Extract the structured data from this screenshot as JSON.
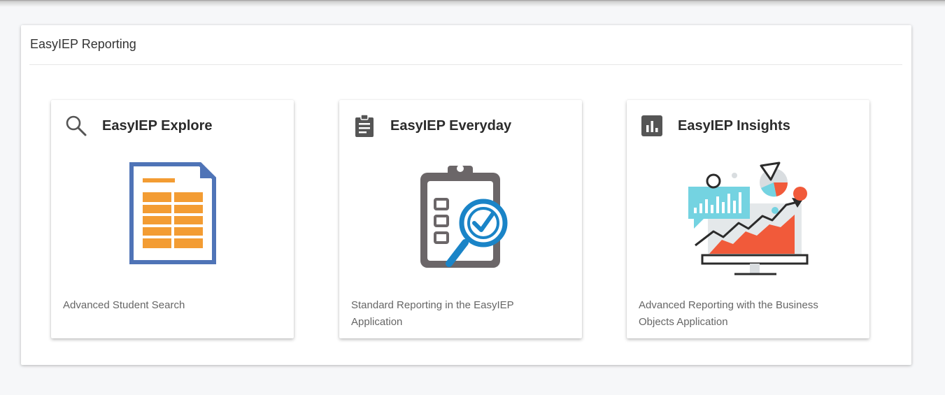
{
  "panel": {
    "title": "EasyIEP Reporting"
  },
  "cards": [
    {
      "title": "EasyIEP Explore",
      "description": "Advanced Student Search",
      "head_icon": "search-icon",
      "illustration": "spreadsheet-document-illustration"
    },
    {
      "title": "EasyIEP Everyday",
      "description": "Standard Reporting in the EasyIEP Application",
      "head_icon": "clipboard-icon",
      "illustration": "clipboard-checklist-magnifier-illustration"
    },
    {
      "title": "EasyIEP Insights",
      "description": "Advanced Reporting with the Business Objects Application",
      "head_icon": "bar-chart-icon",
      "illustration": "analytics-monitor-illustration"
    }
  ],
  "colors": {
    "page_background": "#f6f7f9",
    "icon_gray": "#555555",
    "doc_blue": "#4f74b7",
    "doc_orange": "#f39c33",
    "clipboard_gray": "#6b6668",
    "magnifier_blue": "#1a84c7",
    "insight_teal": "#74d3e1",
    "insight_red": "#f15a3a"
  }
}
